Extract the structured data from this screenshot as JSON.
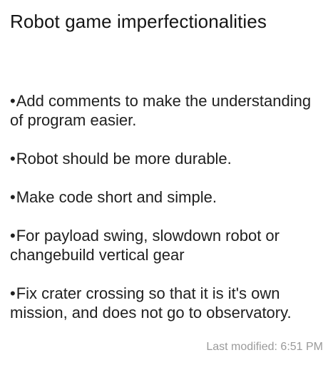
{
  "note": {
    "title": "Robot game imperfectionalities",
    "bullet": "•",
    "items": [
      {
        "text": "Add comments to make the understanding of program easier."
      },
      {
        "text": "Robot should be more durable."
      },
      {
        "text": "Make code short and simple."
      },
      {
        "text": "For payload swing, slowdown robot or changebuild vertical gear"
      },
      {
        "text": "Fix crater crossing so that it is it's own mission, and does not go to observatory."
      }
    ],
    "last_modified": "Last modified: 6:51 PM"
  }
}
